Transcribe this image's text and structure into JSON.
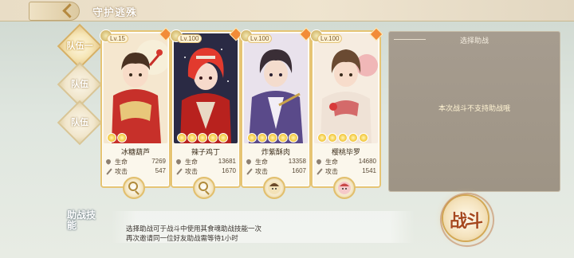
{
  "header": {
    "title": "守护逃殊"
  },
  "team_tabs": [
    "队伍一",
    "队伍",
    "队伍"
  ],
  "stat_labels": {
    "hp": "生命",
    "atk": "攻击"
  },
  "cards": [
    {
      "level": "Lv.15",
      "name": "冰糖葫芦",
      "hp": "7269",
      "atk": "547",
      "skill_icon": "magnifier-icon"
    },
    {
      "level": "Lv.100",
      "name": "辣子鸡丁",
      "hp": "13681",
      "atk": "1670",
      "skill_icon": "magnifier-icon"
    },
    {
      "level": "Lv.100",
      "name": "炸紫酥肉",
      "hp": "13358",
      "atk": "1607",
      "skill_icon": "companion-portrait-icon"
    },
    {
      "level": "Lv.100",
      "name": "樱桃毕罗",
      "hp": "14680",
      "atk": "1541",
      "skill_icon": "companion-portrait-icon"
    }
  ],
  "assist": {
    "title": "选择助战",
    "message": "本次战斗不支持助战哦"
  },
  "assist_skill": {
    "label": "助战技能",
    "line1": "选择助战可于战斗中使用其食魂助战技能一次",
    "line2": "再次邀请同一位好友助战需等待1小时"
  },
  "fight_button": {
    "label": "战斗"
  },
  "colors": {
    "accent_gold": "#e6c473",
    "panel_gray": "#a69c8f",
    "fight_red": "#a6481e"
  }
}
